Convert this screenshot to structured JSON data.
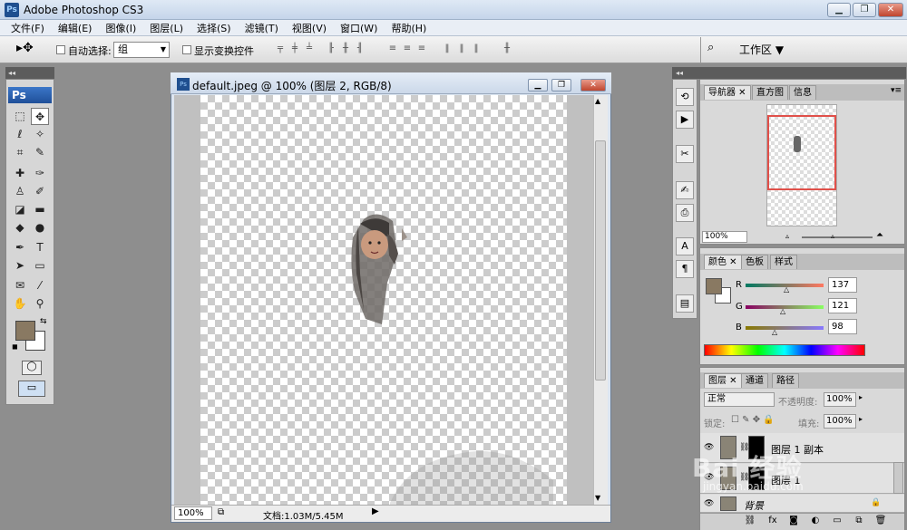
{
  "app": {
    "title": "Adobe Photoshop CS3",
    "icon": "Ps"
  },
  "menu": [
    "文件(F)",
    "编辑(E)",
    "图像(I)",
    "图层(L)",
    "选择(S)",
    "滤镜(T)",
    "视图(V)",
    "窗口(W)",
    "帮助(H)"
  ],
  "options": {
    "auto_select_label": "自动选择:",
    "auto_select_value": "组",
    "show_transform_label": "显示变换控件",
    "workspace_label": "工作区"
  },
  "toolbox": {
    "logo": "Ps",
    "fg_color": "#897962",
    "bg_color": "#ffffff"
  },
  "document": {
    "title": "default.jpeg @ 100% (图层 2, RGB/8)",
    "zoom": "100%",
    "doc_info": "文档:1.03M/5.45M"
  },
  "navigator": {
    "tabs": [
      "导航器",
      "直方图",
      "信息"
    ],
    "zoom": "100%"
  },
  "color": {
    "tabs": [
      "颜色",
      "色板",
      "样式"
    ],
    "r_label": "R",
    "g_label": "G",
    "b_label": "B",
    "r": "137",
    "g": "121",
    "b": "98"
  },
  "layers": {
    "tabs": [
      "图层",
      "通道",
      "路径"
    ],
    "blend_mode": "正常",
    "opacity_label": "不透明度:",
    "opacity": "100%",
    "lock_label": "锁定:",
    "fill_label": "填充:",
    "fill": "100%",
    "items": [
      {
        "name": "图层 1 副本"
      },
      {
        "name": "图层 1"
      },
      {
        "name": "背景"
      }
    ]
  },
  "watermark": {
    "text": "Bai 经验",
    "sub": "jingyan.baidu.com"
  }
}
